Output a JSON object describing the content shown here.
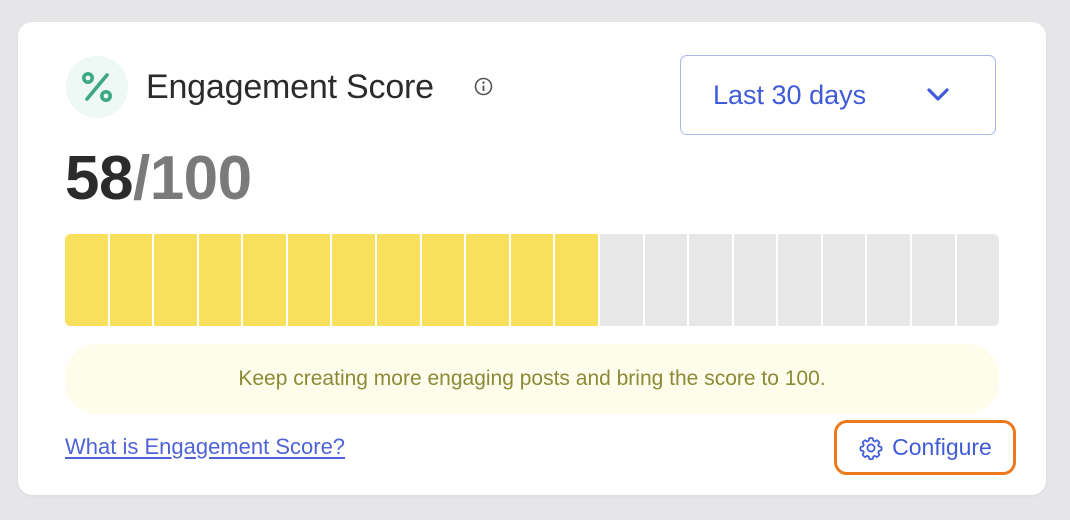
{
  "widget": {
    "title": "Engagement Score",
    "header_icon": "percent-icon",
    "info_icon": "info-icon",
    "score": {
      "value": "58",
      "max": "/100",
      "fraction": 0.58
    },
    "period_dropdown": {
      "selected": "Last 30 days",
      "icon": "chevron-down-icon"
    },
    "progress": {
      "total_segments": 21,
      "filled_segments": 12,
      "fill_color": "#f8df5c",
      "empty_color": "#e7e7e7"
    },
    "hint_text": "Keep creating more engaging posts and bring the score to 100.",
    "help_link": "What is Engagement Score?",
    "configure": {
      "label": "Configure",
      "icon": "gear-icon"
    }
  },
  "colors": {
    "accent_blue": "#3f5bd8",
    "accent_green": "#3ea886",
    "highlight_orange": "#ec7a1c",
    "hint_text": "#8c8a36"
  }
}
